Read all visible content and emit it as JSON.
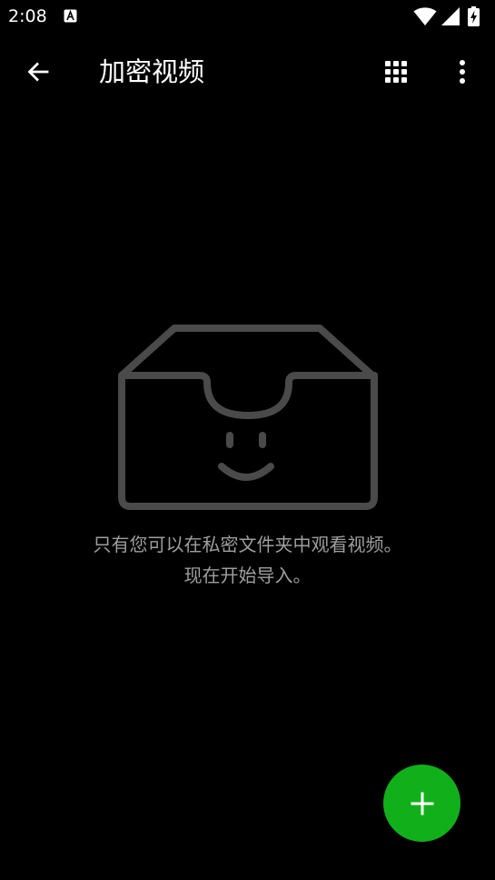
{
  "status_bar": {
    "time": "2:08",
    "app_icon": "accessibility-a-icon",
    "icons": [
      "wifi-icon",
      "signal-icon",
      "battery-charging-icon"
    ]
  },
  "toolbar": {
    "title": "加密视频",
    "back_icon": "arrow-back-icon",
    "grid_icon": "grid-view-icon",
    "more_icon": "more-vert-icon"
  },
  "empty_state": {
    "illustration_icon": "smiling-empty-box-icon",
    "line1": "只有您可以在私密文件夹中观看视频。",
    "line2": "现在开始导入。"
  },
  "fab": {
    "icon": "plus-icon"
  },
  "colors": {
    "background": "#000000",
    "text_primary": "#ffffff",
    "text_secondary": "#9e9e9e",
    "illustration": "#4a4a4a",
    "accent": "#11b01a"
  }
}
